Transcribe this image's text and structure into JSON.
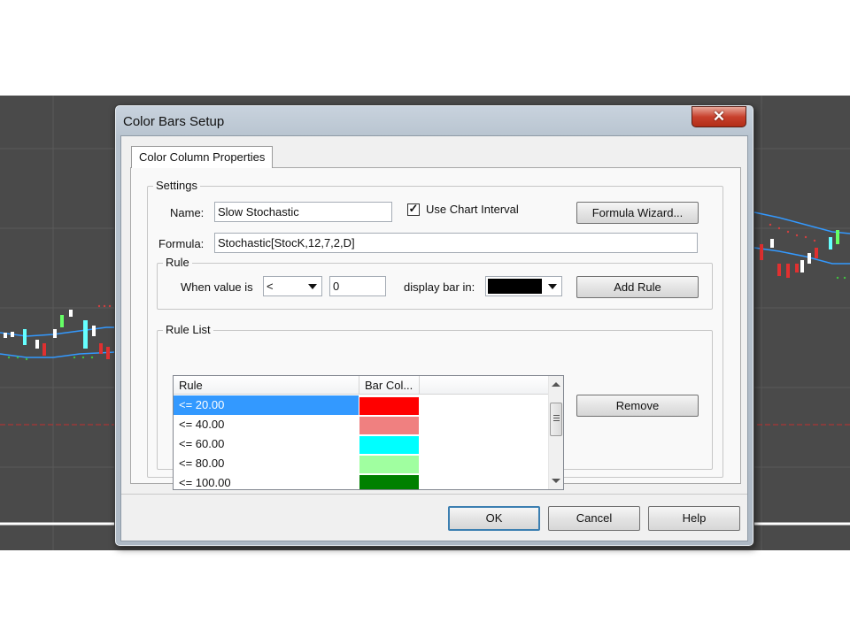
{
  "window": {
    "title": "Color Bars Setup"
  },
  "tab": {
    "label": "Color Column Properties"
  },
  "settings": {
    "group_label": "Settings",
    "name_label": "Name:",
    "name_value": "Slow Stochastic",
    "use_chart_interval_label": "Use Chart Interval",
    "use_chart_interval_checked": true,
    "formula_wizard_label": "Formula Wizard...",
    "formula_label": "Formula:",
    "formula_value": "Stochastic[StocK,12,7,2,D]"
  },
  "rule": {
    "group_label": "Rule",
    "when_value_label": "When value is",
    "operator_value": "<",
    "threshold_value": "0",
    "display_bar_label": "display bar in:",
    "bar_color": "#000000",
    "add_rule_label": "Add Rule"
  },
  "rule_list": {
    "group_label": "Rule List",
    "columns": [
      "Rule",
      "Bar Col..."
    ],
    "rows": [
      {
        "rule": "<= 20.00",
        "color": "#ff0000",
        "selected": true
      },
      {
        "rule": "<= 40.00",
        "color": "#f08080",
        "selected": false
      },
      {
        "rule": "<= 60.00",
        "color": "#00ffff",
        "selected": false
      },
      {
        "rule": "<= 80.00",
        "color": "#a0ffa0",
        "selected": false
      },
      {
        "rule": "<= 100.00",
        "color": "#008000",
        "selected": false
      }
    ],
    "remove_label": "Remove"
  },
  "buttons": {
    "ok": "OK",
    "cancel": "Cancel",
    "help": "Help"
  },
  "colors": {
    "chart_bg": "#4a4a4a",
    "selection": "#3399ff",
    "close_button": "#c8412d"
  }
}
